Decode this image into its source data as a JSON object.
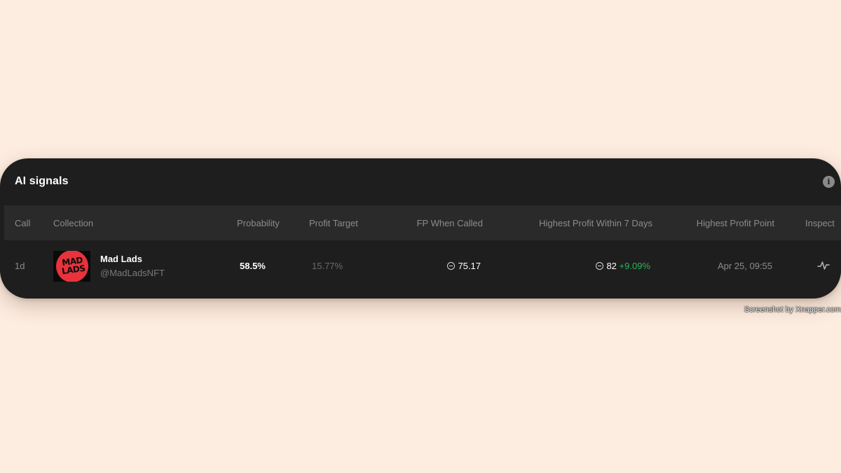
{
  "card": {
    "title": "AI signals",
    "info_icon": "info-icon"
  },
  "table": {
    "headers": {
      "call": "Call",
      "collection": "Collection",
      "probability": "Probability",
      "profit_target": "Profit Target",
      "fp_when_called": "FP When Called",
      "highest_profit_7d": "Highest Profit Within 7 Days",
      "highest_profit_point": "Highest Profit Point",
      "inspect": "Inspect"
    },
    "rows": [
      {
        "call": "1d",
        "collection_name": "Mad Lads",
        "collection_handle": "@MadLadsNFT",
        "collection_logo_text": "MAD LADS",
        "probability": "58.5%",
        "profit_target": "15.77%",
        "fp_when_called": "75.17",
        "highest_profit_value": "82",
        "highest_profit_change": "+9.09%",
        "highest_profit_point": "Apr 25, 09:55",
        "inspect_icon": "pulse-icon",
        "currency_icon": "sol-currency-icon"
      }
    ]
  },
  "watermark": "Screenshot by Xnapper.com",
  "colors": {
    "background": "#fdece0",
    "card": "#1e1e1e",
    "header_row": "#2a2a2a",
    "positive": "#2fb35a",
    "logo_red": "#e8323c"
  }
}
